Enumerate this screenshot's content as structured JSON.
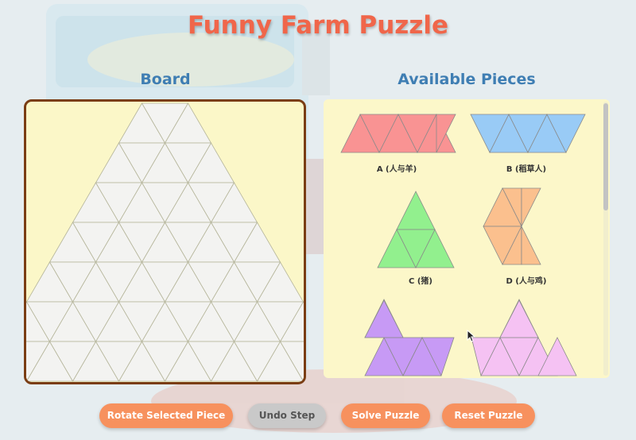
{
  "title": "Funny Farm Puzzle",
  "board": {
    "heading": "Board",
    "rows": 7
  },
  "pieces_panel": {
    "heading": "Available Pieces",
    "pieces": [
      {
        "label": "A (人与羊)",
        "color": "#f99393"
      },
      {
        "label": "B (稻草人)",
        "color": "#99cbf6"
      },
      {
        "label": "C (猪)",
        "color": "#92f08e"
      },
      {
        "label": "D (人与鸡)",
        "color": "#fbc08e"
      },
      {
        "label": "",
        "color": "#c79af5"
      },
      {
        "label": "",
        "color": "#f5c2f3"
      }
    ]
  },
  "buttons": {
    "rotate": "Rotate Selected Piece",
    "undo": "Undo Step",
    "solve": "Solve Puzzle",
    "reset": "Reset Puzzle"
  },
  "colors": {
    "title": "#f0664a",
    "heading": "#3f7eb3",
    "board_border": "#7a3d14",
    "cell_fill": "#f3f3f1",
    "grid_line": "#b5b59a",
    "button": "#f7915e",
    "button_disabled": "#c9c9c9"
  }
}
